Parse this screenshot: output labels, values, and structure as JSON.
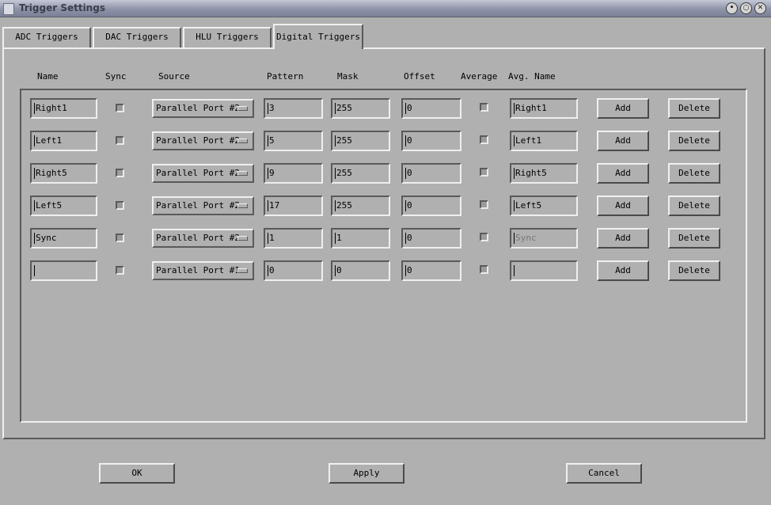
{
  "window": {
    "title": "Trigger Settings"
  },
  "tabs": [
    {
      "label": "ADC Triggers"
    },
    {
      "label": "DAC Triggers"
    },
    {
      "label": "HLU Triggers"
    },
    {
      "label": "Digital Triggers",
      "active": true
    }
  ],
  "columns": {
    "name": "Name",
    "sync": "Sync",
    "source": "Source",
    "pattern": "Pattern",
    "mask": "Mask",
    "offset": "Offset",
    "average": "Average",
    "avg_name": "Avg. Name"
  },
  "rows": [
    {
      "name": "Right1",
      "sync": false,
      "source": "Parallel Port #2",
      "pattern": "3",
      "mask": "255",
      "offset": "0",
      "average": false,
      "avg_name": "Right1",
      "avg_name_dim": false,
      "add": "Add",
      "delete": "Delete"
    },
    {
      "name": "Left1",
      "sync": false,
      "source": "Parallel Port #2",
      "pattern": "5",
      "mask": "255",
      "offset": "0",
      "average": false,
      "avg_name": "Left1",
      "avg_name_dim": false,
      "add": "Add",
      "delete": "Delete"
    },
    {
      "name": "Right5",
      "sync": false,
      "source": "Parallel Port #2",
      "pattern": "9",
      "mask": "255",
      "offset": "0",
      "average": false,
      "avg_name": "Right5",
      "avg_name_dim": false,
      "add": "Add",
      "delete": "Delete"
    },
    {
      "name": "Left5",
      "sync": false,
      "source": "Parallel Port #2",
      "pattern": "17",
      "mask": "255",
      "offset": "0",
      "average": false,
      "avg_name": "Left5",
      "avg_name_dim": false,
      "add": "Add",
      "delete": "Delete"
    },
    {
      "name": "Sync",
      "sync": false,
      "source": "Parallel Port #2",
      "pattern": "1",
      "mask": "1",
      "offset": "0",
      "average": false,
      "avg_name": "Sync",
      "avg_name_dim": true,
      "add": "Add",
      "delete": "Delete"
    },
    {
      "name": "",
      "sync": false,
      "source": "Parallel Port #1",
      "pattern": "0",
      "mask": "0",
      "offset": "0",
      "average": false,
      "avg_name": "",
      "avg_name_dim": false,
      "add": "Add",
      "delete": "Delete"
    }
  ],
  "footer": {
    "ok": "OK",
    "apply": "Apply",
    "cancel": "Cancel"
  }
}
